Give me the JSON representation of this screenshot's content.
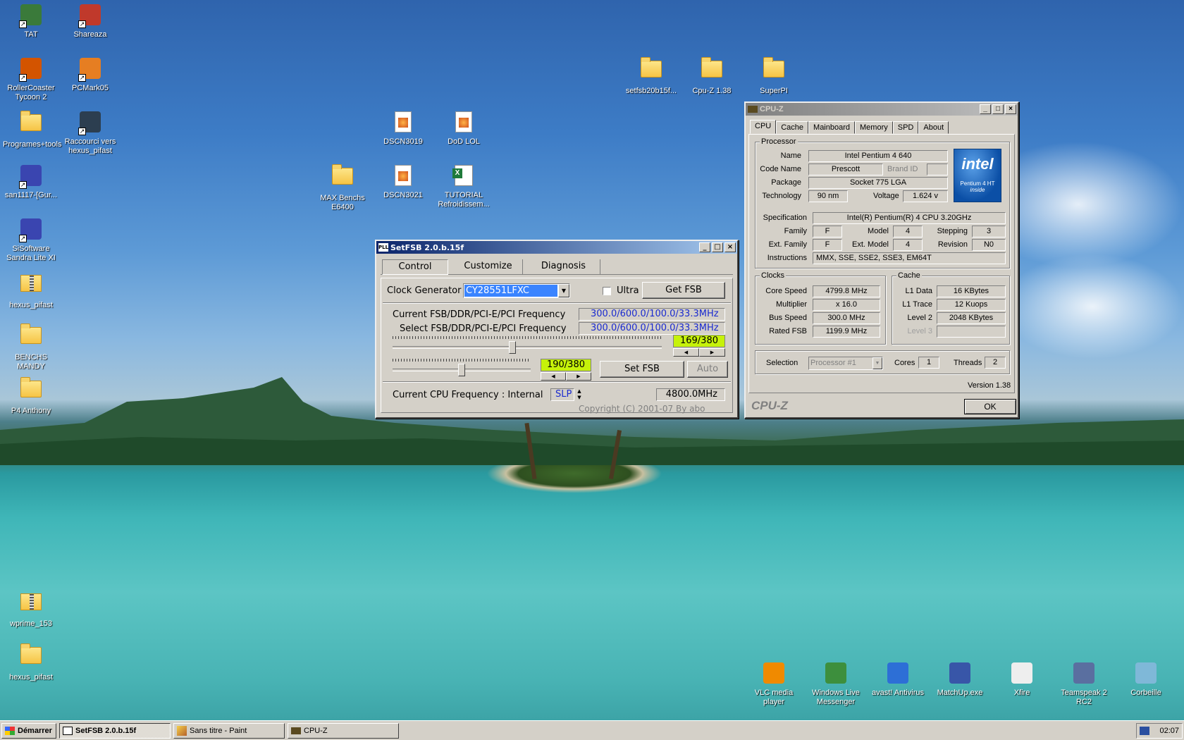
{
  "desktop": {
    "icons": [
      {
        "label": "TAT",
        "type": "gen",
        "color": "#3a7a3a"
      },
      {
        "label": "Shareaza",
        "type": "gen",
        "color": "#c0392b"
      },
      {
        "label": "RollerCoaster Tycoon 2",
        "type": "gen",
        "color": "#d35400"
      },
      {
        "label": "PCMark05",
        "type": "gen",
        "color": "#e67e22"
      },
      {
        "label": "Programes+tools",
        "type": "folder"
      },
      {
        "label": "Raccourci vers hexus_pifast",
        "type": "gen",
        "color": "#2c3e50"
      },
      {
        "label": "san1117-[Gur...",
        "type": "gen",
        "color": "#3a45b0"
      },
      {
        "label": "SiSoftware Sandra Lite XI",
        "type": "gen",
        "color": "#3a45b0"
      },
      {
        "label": "hexus_pifast",
        "type": "zip"
      },
      {
        "label": "BENCHS MANDY",
        "type": "folder"
      },
      {
        "label": "P4 Anthony",
        "type": "folder"
      },
      {
        "label": "wprime_153",
        "type": "zip"
      },
      {
        "label": "hexus_pifast",
        "type": "folder"
      },
      {
        "label": "setfsb20b15f...",
        "type": "folder"
      },
      {
        "label": "Cpu-Z 1.38",
        "type": "folder"
      },
      {
        "label": "SuperPI",
        "type": "folder"
      },
      {
        "label": "DSCN3019",
        "type": "img"
      },
      {
        "label": "DoD LOL",
        "type": "img"
      },
      {
        "label": "MAX Benchs E6400",
        "type": "folder"
      },
      {
        "label": "DSCN3021",
        "type": "img"
      },
      {
        "label": "TUTORIAL Refroidissem...",
        "type": "xls"
      },
      {
        "label": "VLC media player",
        "type": "gen",
        "color": "#f08a00"
      },
      {
        "label": "Windows Live Messenger",
        "type": "gen",
        "color": "#3d8f3d"
      },
      {
        "label": "avast! Antivirus",
        "type": "gen",
        "color": "#2d6fd6"
      },
      {
        "label": "MatchUp.exe",
        "type": "gen",
        "color": "#3856a8"
      },
      {
        "label": "Xfire",
        "type": "gen",
        "color": "#eeeeee"
      },
      {
        "label": "Teamspeak 2 RC2",
        "type": "gen",
        "color": "#5a6fa0"
      },
      {
        "label": "Corbeille",
        "type": "gen",
        "color": "#7fb8d8"
      }
    ]
  },
  "setfsb": {
    "title": "SetFSB 2.0.b.15f",
    "tabs": [
      "Control",
      "Customize",
      "Diagnosis"
    ],
    "clock_generator_label": "Clock Generator",
    "clock_generator_value": "CY28551LFXC",
    "ultra_label": "Ultra",
    "get_fsb": "Get FSB",
    "current_freq_label": "Current FSB/DDR/PCI-E/PCI Frequency",
    "current_freq_value": "300.0/600.0/100.0/33.3MHz",
    "select_freq_label": "Select FSB/DDR/PCI-E/PCI Frequency",
    "select_freq_value": "300.0/600.0/100.0/33.3MHz",
    "slider1_value": "169/380",
    "slider1_level": 0.445,
    "slider2_value": "190/380",
    "slider2_level": 0.5,
    "set_fsb": "Set FSB",
    "auto": "Auto",
    "cpu_freq_label": "Current CPU Frequency : Internal",
    "slp": "SLP",
    "cpu_freq_value": "4800.0MHz",
    "copyright": "Copyright (C) 2001-07 By abo"
  },
  "cpuz": {
    "title": "CPU-Z",
    "tabs": [
      "CPU",
      "Cache",
      "Mainboard",
      "Memory",
      "SPD",
      "About"
    ],
    "processor_group": "Processor",
    "name_label": "Name",
    "name": "Intel Pentium 4 640",
    "codename_label": "Code Name",
    "codename": "Prescott",
    "brandid_label": "Brand ID",
    "package_label": "Package",
    "package": "Socket 775 LGA",
    "technology_label": "Technology",
    "technology": "90 nm",
    "voltage_label": "Voltage",
    "voltage": "1.624 v",
    "spec_label": "Specification",
    "spec": "Intel(R) Pentium(R) 4 CPU 3.20GHz",
    "family_label": "Family",
    "family": "F",
    "model_label": "Model",
    "model": "4",
    "stepping_label": "Stepping",
    "stepping": "3",
    "extfamily_label": "Ext. Family",
    "extfamily": "F",
    "extmodel_label": "Ext. Model",
    "extmodel": "4",
    "revision_label": "Revision",
    "revision": "N0",
    "instructions_label": "Instructions",
    "instructions": "MMX, SSE, SSE2, SSE3, EM64T",
    "clocks_group": "Clocks",
    "corespeed_label": "Core Speed",
    "corespeed": "4799.8 MHz",
    "multiplier_label": "Multiplier",
    "multiplier": "x 16.0",
    "busspeed_label": "Bus Speed",
    "busspeed": "300.0 MHz",
    "ratedfsb_label": "Rated FSB",
    "ratedfsb": "1199.9 MHz",
    "cache_group": "Cache",
    "l1data_label": "L1 Data",
    "l1data": "16 KBytes",
    "l1trace_label": "L1 Trace",
    "l1trace": "12 Kuops",
    "level2_label": "Level 2",
    "level2": "2048 KBytes",
    "level3_label": "Level 3",
    "selection_label": "Selection",
    "selection": "Processor #1",
    "cores_label": "Cores",
    "cores": "1",
    "threads_label": "Threads",
    "threads": "2",
    "version": "Version 1.38",
    "brand": "CPU-Z",
    "ok": "OK",
    "logo_main": "intel",
    "logo_sub": "Pentium 4 HT",
    "logo_inside": "inside"
  },
  "taskbar": {
    "start": "Démarrer",
    "items": [
      "SetFSB 2.0.b.15f",
      "Sans titre - Paint",
      "CPU-Z"
    ],
    "clock": "02:07"
  }
}
